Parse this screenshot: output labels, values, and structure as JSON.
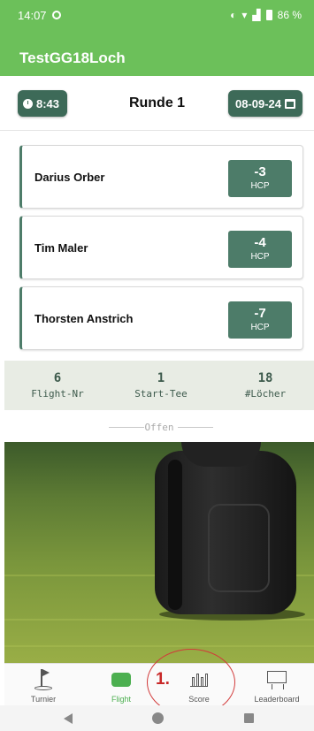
{
  "status_bar": {
    "time": "14:07",
    "battery": "86 %"
  },
  "app_bar": {
    "title": "TestGG18Loch"
  },
  "round": {
    "time": "8:43",
    "title": "Runde 1",
    "date": "08-09-24"
  },
  "players": [
    {
      "name": "Darius Orber",
      "hcp": "-3",
      "hcp_label": "HCP"
    },
    {
      "name": "Tim Maler",
      "hcp": "-4",
      "hcp_label": "HCP"
    },
    {
      "name": "Thorsten Anstrich",
      "hcp": "-7",
      "hcp_label": "HCP"
    }
  ],
  "info": [
    {
      "value": "6",
      "label": "Flight-Nr"
    },
    {
      "value": "1",
      "label": "Start-Tee"
    },
    {
      "value": "18",
      "label": "#Löcher"
    }
  ],
  "flight_status": "Offen",
  "bottom_nav": [
    {
      "label": "Turnier",
      "icon": "flag-icon",
      "active": false
    },
    {
      "label": "Flight",
      "icon": "flight-icon",
      "active": true
    },
    {
      "label": "Score",
      "icon": "bar-chart-icon",
      "active": false
    },
    {
      "label": "Leaderboard",
      "icon": "leaderboard-icon",
      "active": false
    }
  ],
  "annotation": {
    "label": "1."
  },
  "colors": {
    "accent": "#6cc05a",
    "dark_green": "#3d6a58",
    "hcp_green": "#4d7c69",
    "active_nav": "#4caf50",
    "annotation_red": "#c82828"
  }
}
